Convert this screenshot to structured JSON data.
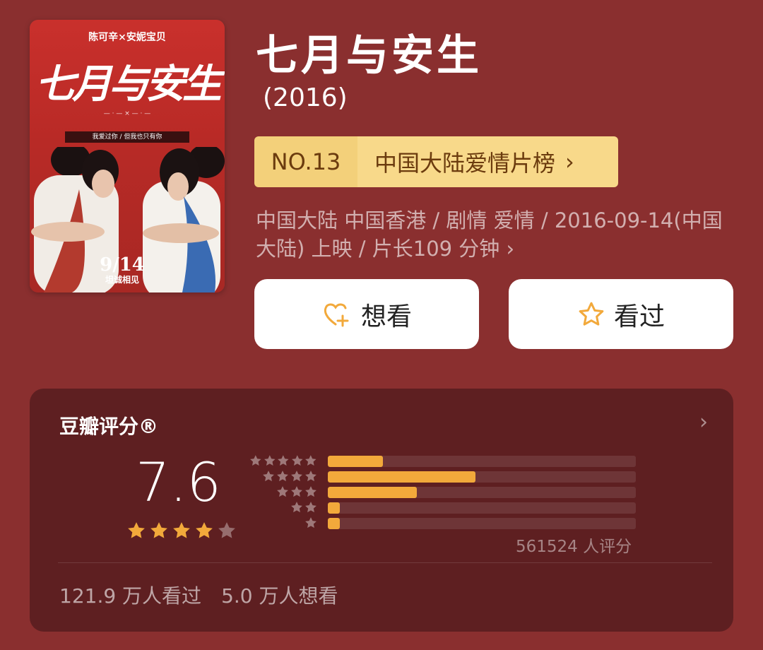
{
  "poster": {
    "credits": "陈可辛×安妮宝贝",
    "title": "七月与安生",
    "tag": "我爱过你 / 但我也只有你",
    "date": "9/14",
    "tagline": "坦诚相见"
  },
  "movie": {
    "title": "七月与安生",
    "year": "(2016)"
  },
  "rank": {
    "number": "NO.13",
    "list_name": "中国大陆爱情片榜"
  },
  "meta": "中国大陆 中国香港 / 剧情 爱情 / 2016-09-14(中国大陆) 上映 / 片长109 分钟",
  "buttons": {
    "want_label": "想看",
    "seen_label": "看过"
  },
  "rating": {
    "title": "豆瓣评分®",
    "score": "7.6",
    "stars": 4,
    "distribution": [
      {
        "stars": 5,
        "fraction": 0.18
      },
      {
        "stars": 4,
        "fraction": 0.48
      },
      {
        "stars": 3,
        "fraction": 0.29
      },
      {
        "stars": 2,
        "fraction": 0.04
      },
      {
        "stars": 1,
        "fraction": 0.04
      }
    ],
    "count_text": "561524 人评分",
    "seen_text": "121.9 万人看过",
    "want_text": "5.0 万人想看"
  },
  "colors": {
    "background": "#8a2f2f",
    "card": "#5e1f21",
    "accent": "#f2a93b",
    "rank_badge": "#f8d98a"
  }
}
